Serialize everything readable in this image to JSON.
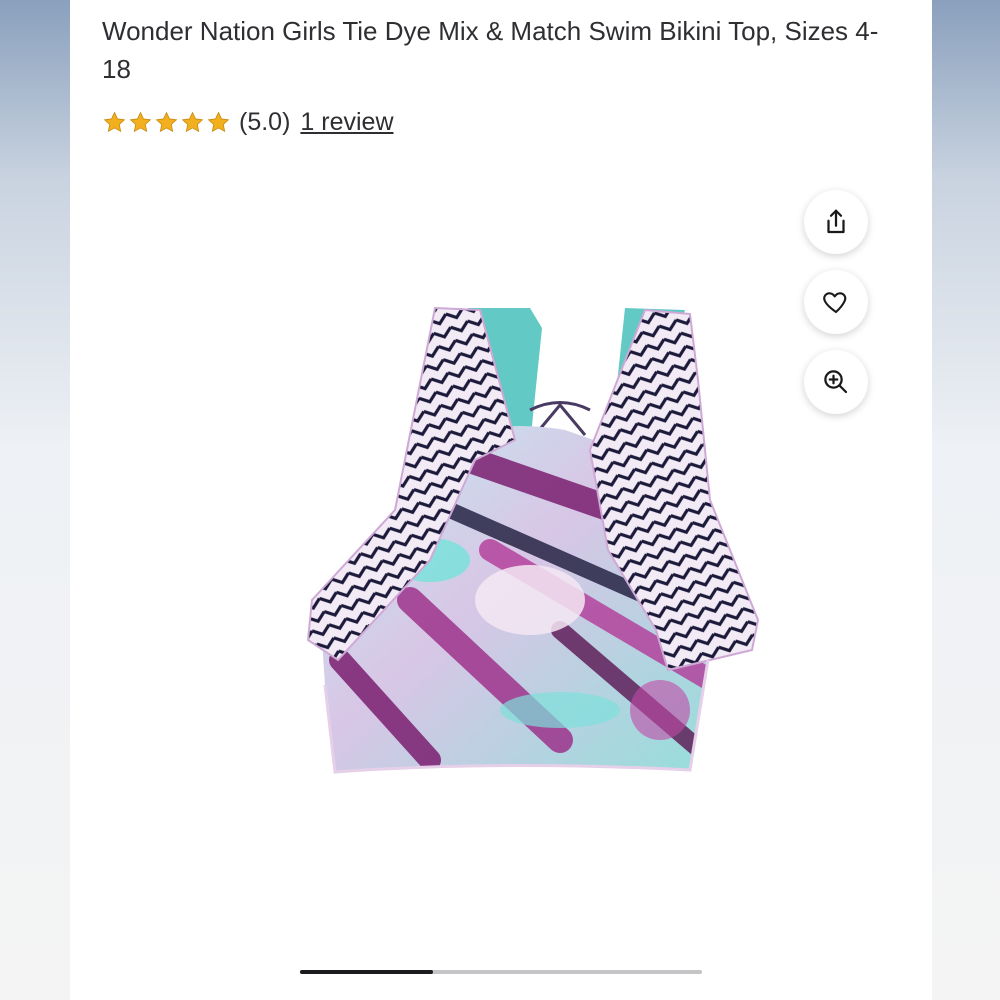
{
  "product": {
    "title": "Wonder Nation Girls Tie Dye Mix & Match Swim Bikini Top, Sizes 4-18",
    "rating_value": "(5.0)",
    "star_count": 5,
    "rating_stars": 5,
    "review_link": "1 review"
  },
  "actions": {
    "share_icon": "share-icon",
    "favorite_icon": "heart-icon",
    "zoom_icon": "zoom-in-icon"
  },
  "gallery": {
    "image_subject": "tie dye bikini top",
    "progress": 0.33
  },
  "colors": {
    "star": "#f2b01e",
    "text": "#2e2f32",
    "track": "#c5c5c8",
    "thumb": "#1c1c1e",
    "fabric_teal": "#7fe0dc",
    "fabric_magenta": "#9c2a86",
    "fabric_navy": "#1c1a3a"
  }
}
